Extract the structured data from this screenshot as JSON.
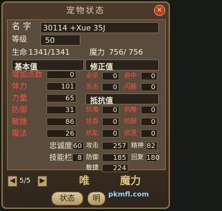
{
  "panel": {
    "title": "宠物状态",
    "close": "×",
    "name_label": "名 字",
    "name_value": "30114 +Xue 35J",
    "level_label": "等级",
    "level_value": "50",
    "hp_label": "生命",
    "hp_value": "1341/1341",
    "mp_label": "魔力",
    "mp_value": "756/ 756"
  },
  "basic": {
    "title": "基本值",
    "left_rows": [
      {
        "label": "增加点数",
        "value": "0"
      },
      {
        "label": "体力",
        "value": "101"
      },
      {
        "label": "力量",
        "value": "65"
      },
      {
        "label": "防御",
        "value": "31"
      },
      {
        "label": "敏捷",
        "value": "86"
      },
      {
        "label": "魔法",
        "value": "26"
      }
    ],
    "correction_title": "修正值",
    "correction_rows": [
      {
        "left_label": "必杀",
        "left_value": "0",
        "right_label": "命中",
        "right_value": "0"
      },
      {
        "left_label": "反击",
        "left_value": "0",
        "right_label": "闪躲",
        "right_value": "0"
      }
    ],
    "resist_title": "抵抗值",
    "resist_rows": [
      {
        "left_label": "抗毒",
        "left_value": "0",
        "right_label": "抗睡",
        "right_value": "0"
      },
      {
        "left_label": "抗昏",
        "left_value": "0",
        "right_label": "抗醉",
        "right_value": "0"
      },
      {
        "left_label": "抗乱",
        "left_value": "0",
        "right_label": "抗遗",
        "right_value": "0"
      }
    ],
    "loyalty_label": "忠诚度",
    "loyalty_value": "60",
    "skills_label": "技能栏",
    "skills_value": "8",
    "attack_label": "攻击",
    "attack_value": "257",
    "spirit_label": "精神",
    "spirit_value": "82",
    "defense_label": "防御",
    "defense_value": "185",
    "recover_label": "回复",
    "recover_value": "180",
    "agility_label": "敏捷",
    "agility_value": "224"
  },
  "pager": {
    "label": "5/5"
  },
  "tabs": {
    "status": "状态",
    "detail": "明"
  },
  "brand": {
    "text1": "唯",
    "text2": "魔力",
    "text3": "pkmfl.com"
  }
}
